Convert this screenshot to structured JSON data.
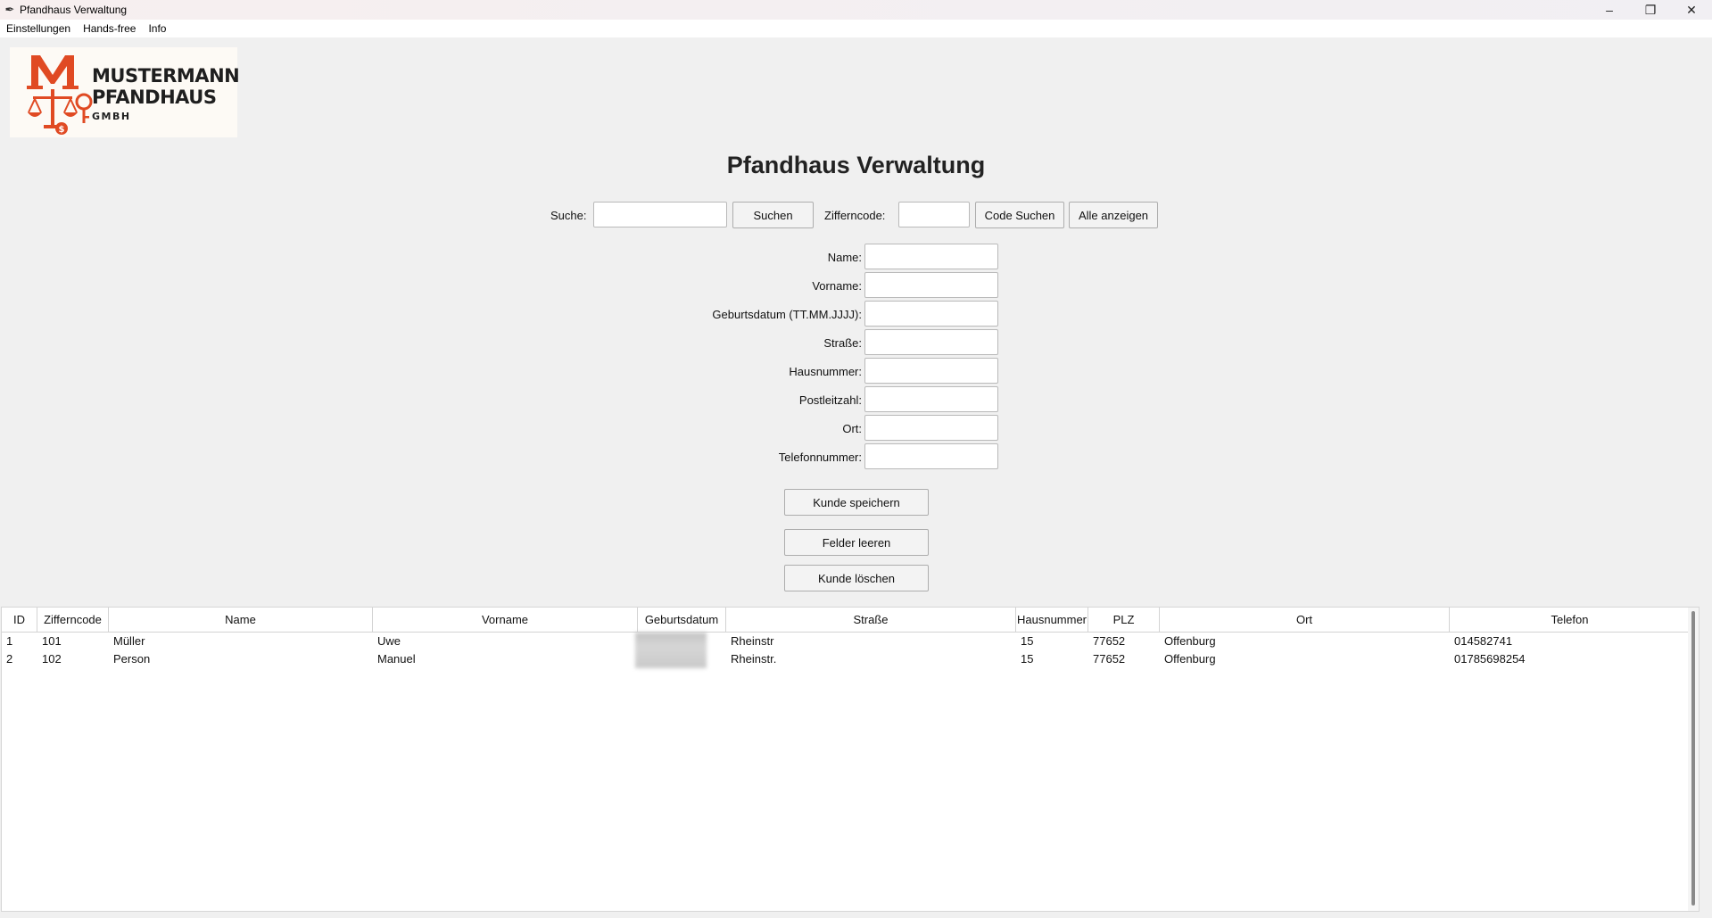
{
  "window": {
    "title": "Pfandhaus Verwaltung",
    "app_icon": "feather-icon"
  },
  "menu": [
    "Einstellungen",
    "Hands-free",
    "Info"
  ],
  "logo": {
    "line1": "MUSTERMANN",
    "line2": "PFANDHAUS",
    "line3": "GMBH",
    "color": "#e04a23"
  },
  "title": "Pfandhaus Verwaltung",
  "search": {
    "label": "Suche:",
    "value": "",
    "button": "Suchen",
    "code_label": "Zifferncode:",
    "code_value": "",
    "code_button": "Code Suchen",
    "all_button": "Alle anzeigen"
  },
  "form": {
    "name": "Name:",
    "vorname": "Vorname:",
    "geburtsdatum": "Geburtsdatum (TT.MM.JJJJ):",
    "strasse": "Straße:",
    "hausnummer": "Hausnummer:",
    "plz": "Postleitzahl:",
    "ort": "Ort:",
    "telefon": "Telefonnummer:"
  },
  "actions": {
    "save": "Kunde speichern",
    "clear": "Felder leeren",
    "delete": "Kunde löschen"
  },
  "table": {
    "columns": [
      "ID",
      "Zifferncode",
      "Name",
      "Vorname",
      "Geburtsdatum",
      "Straße",
      "Hausnummer",
      "PLZ",
      "Ort",
      "Telefon"
    ],
    "rows": [
      [
        "1",
        "101",
        "Müller",
        "Uwe",
        "",
        "Rheinstr",
        "15",
        "77652",
        "Offenburg",
        "014582741"
      ],
      [
        "2",
        "102",
        "Person",
        "Manuel",
        "",
        "Rheinstr.",
        "15",
        "77652",
        "Offenburg",
        "01785698254"
      ]
    ]
  }
}
